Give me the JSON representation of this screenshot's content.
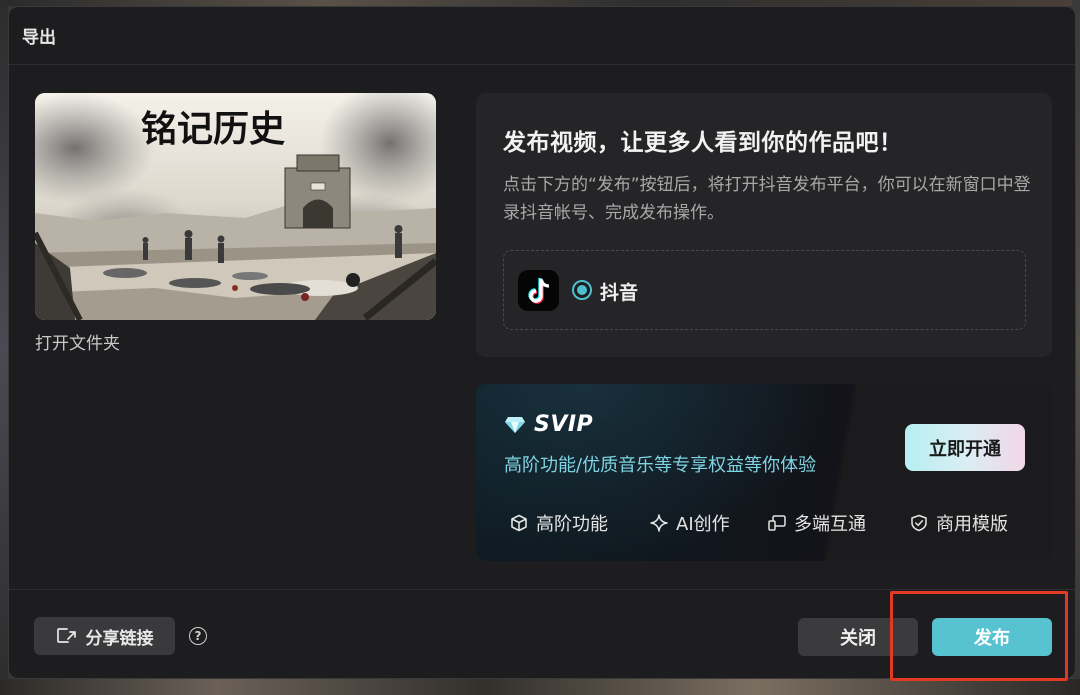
{
  "dialog": {
    "title": "导出"
  },
  "preview": {
    "calligraphy": "铭记历史",
    "open_folder": "打开文件夹"
  },
  "publish": {
    "heading": "发布视频，让更多人看到你的作品吧！",
    "description": "点击下方的“发布”按钮后，将打开抖音发布平台，你可以在新窗口中登录抖音帐号、完成发布操作。",
    "platform": {
      "name": "抖音",
      "selected": true,
      "icon": "tiktok-icon"
    }
  },
  "svip": {
    "title": "SVIP",
    "subtitle": "高阶功能/优质音乐等专享权益等你体验",
    "cta": "立即开通",
    "features": [
      {
        "label": "高阶功能",
        "icon": "cube-icon"
      },
      {
        "label": "AI创作",
        "icon": "sparkle-icon"
      },
      {
        "label": "多端互通",
        "icon": "devices-icon"
      },
      {
        "label": "商用模版",
        "icon": "shield-check-icon"
      }
    ]
  },
  "footer": {
    "share_label": "分享链接",
    "help": "?",
    "close_label": "关闭",
    "publish_label": "发布"
  },
  "colors": {
    "accent": "#57c3d1",
    "highlight": "#e03a24",
    "dialog_bg": "#1d1d1f",
    "card_bg": "#252527"
  }
}
